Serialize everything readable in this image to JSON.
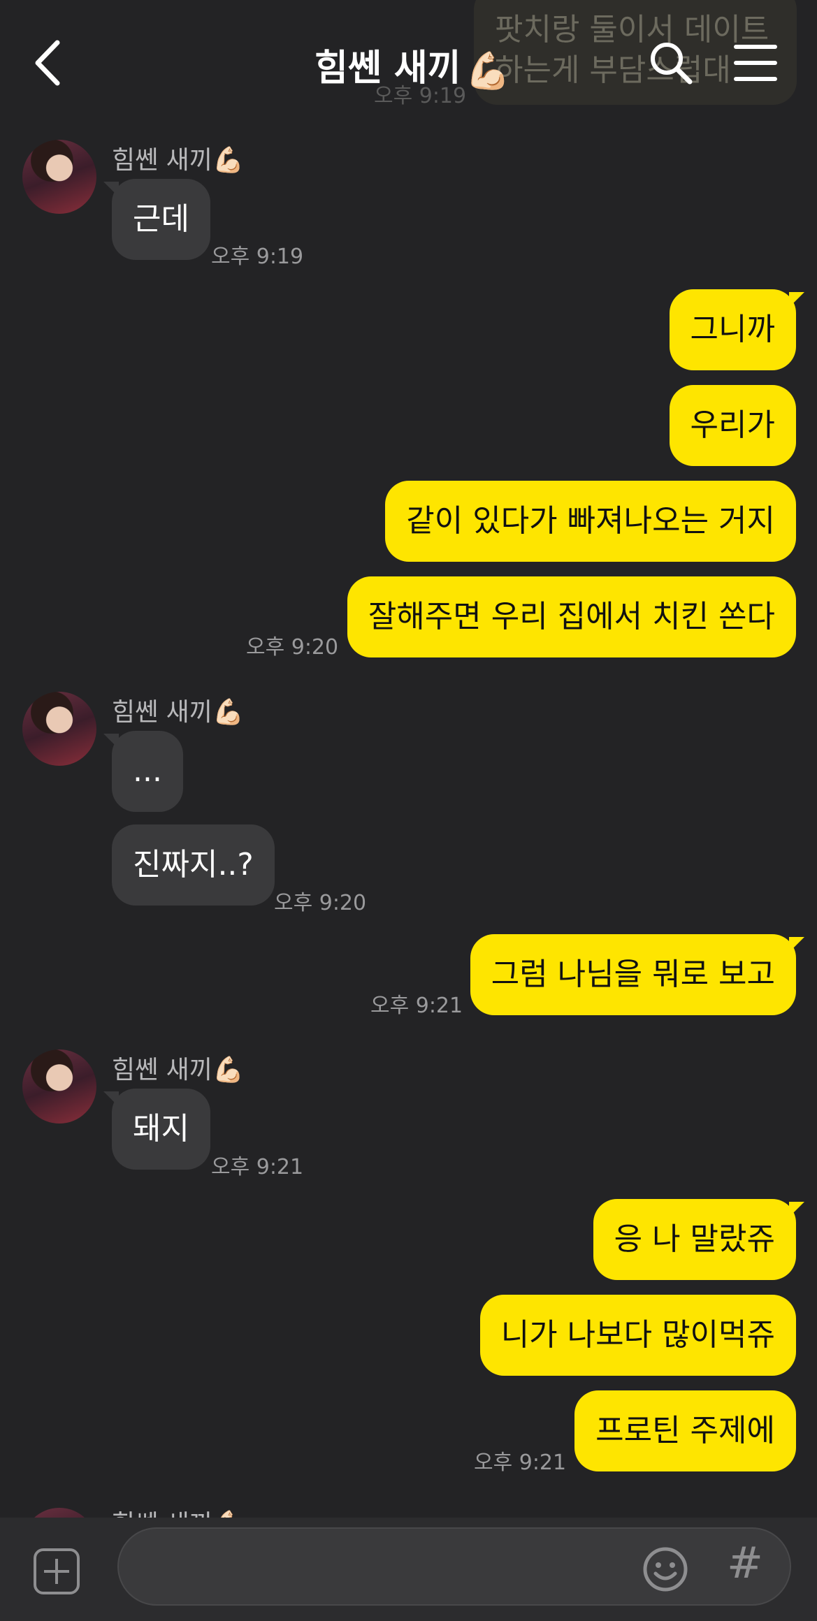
{
  "header": {
    "title": "힘쎈 새끼",
    "title_emoji": "💪🏻",
    "back_icon": "chevron-left-icon",
    "search_icon": "search-icon",
    "menu_icon": "hamburger-menu-icon",
    "ghost_text_line1": "팟치랑 둘이서 데이트",
    "ghost_text_line2": "하는게 부담스럽대",
    "ghost_time": "오후 9:19"
  },
  "sender_name": "힘쎈 새끼",
  "sender_emoji": "💪🏻",
  "groups": [
    {
      "in": [
        "근데"
      ],
      "time": "오후 9:19"
    },
    {
      "out": [
        "그니까",
        "우리가",
        "같이 있다가 빠져나오는 거지",
        "잘해주면 우리 집에서 치킨 쏜다"
      ],
      "time": "오후 9:20"
    },
    {
      "in": [
        "...",
        "진짜지..?"
      ],
      "time": "오후 9:20"
    },
    {
      "out": [
        "그럼 나님을 뭐로 보고"
      ],
      "time": "오후 9:21"
    },
    {
      "in": [
        "돼지"
      ],
      "time": "오후 9:21"
    },
    {
      "out": [
        "응 나 말랐쥬",
        "니가 나보다 많이먹쥬",
        "프로틴 주제에"
      ],
      "time": "오후 9:21"
    }
  ],
  "input": {
    "placeholder": "",
    "plus_icon": "plus-icon",
    "emoji_icon": "emoji-icon",
    "hash_label": "#"
  },
  "colors": {
    "background": "#232325",
    "incoming_bubble": "#3a3a3c",
    "outgoing_bubble": "#fee500"
  }
}
